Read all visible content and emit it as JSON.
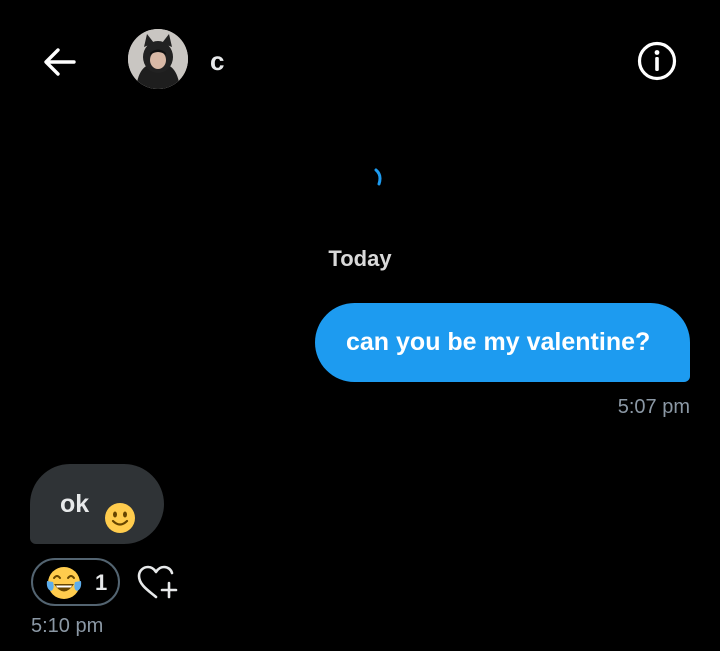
{
  "header": {
    "contact_name": "c",
    "back_icon": "arrow-left-icon",
    "info_icon": "info-icon"
  },
  "conversation": {
    "date_separator": "Today",
    "messages": [
      {
        "direction": "outgoing",
        "text": "can you be my valentine?",
        "time": "5:07 pm"
      },
      {
        "direction": "incoming",
        "text": "ok",
        "emoji": "slightly-smiling-face",
        "time": "5:10 pm",
        "reactions": [
          {
            "emoji": "face-with-tears-of-joy",
            "count": "1"
          }
        ]
      }
    ]
  },
  "colors": {
    "background": "#000000",
    "outgoing_bubble": "#1d9bf0",
    "incoming_bubble": "#2f3336",
    "muted_text": "#8b98a5",
    "primary_text": "#e7e9ea"
  }
}
